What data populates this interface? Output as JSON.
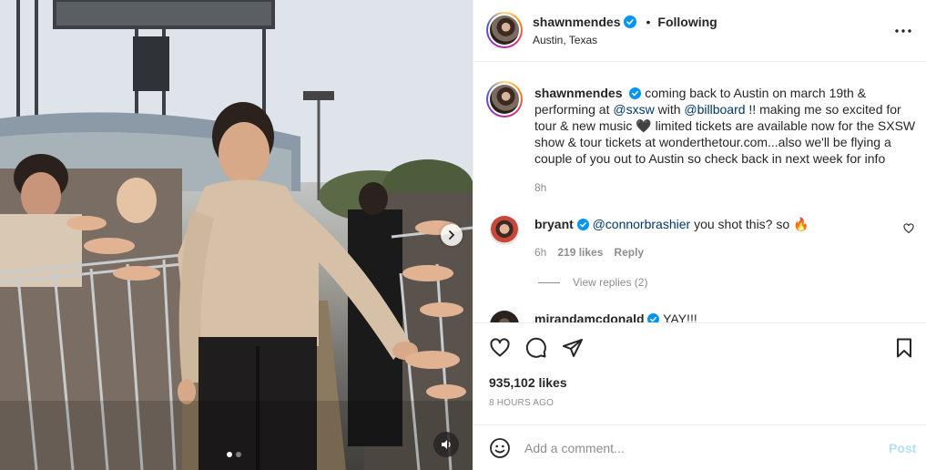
{
  "post": {
    "username": "shawnmendes",
    "follow_status": "Following",
    "separator": "•",
    "location": "Austin, Texas",
    "caption": {
      "t1": "coming back to Austin on march 19th & performing at",
      "m1": "@sxsw",
      "t2": "with",
      "m2": "@billboard",
      "t3": "!! making me so excited for tour & new music 🖤 limited tickets are available now for the SXSW show & tour tickets at wonderthetour.com...also we'll be flying a couple of you out to Austin so check back in next week for info"
    },
    "caption_time": "8h",
    "likes": "935,102 likes",
    "posted_ago": "8 HOURS AGO"
  },
  "comments": [
    {
      "username": "bryant",
      "mention": "@connorbrashier",
      "text": "you shot this? so 🔥",
      "time": "6h",
      "likes": "219 likes",
      "reply_label": "Reply",
      "view_replies": "View replies (2)"
    },
    {
      "username": "mirandamcdonald",
      "text": "YAY!!!"
    }
  ],
  "composer": {
    "placeholder": "Add a comment...",
    "post_label": "Post"
  },
  "icons": {
    "more": "more-horizontal-icon",
    "like": "heart-icon",
    "comment": "comment-icon",
    "share": "paper-plane-icon",
    "save": "bookmark-icon",
    "emoji": "smiley-icon",
    "next": "chevron-right-icon",
    "audio": "speaker-icon",
    "verified": "verified-badge-icon"
  },
  "colors": {
    "verified": "#0095f6",
    "link": "#00376b",
    "secondary_text": "#8e8e8e",
    "post_disabled": "#b2dffc"
  },
  "carousel": {
    "slide_count": 2,
    "active_index": 0
  }
}
